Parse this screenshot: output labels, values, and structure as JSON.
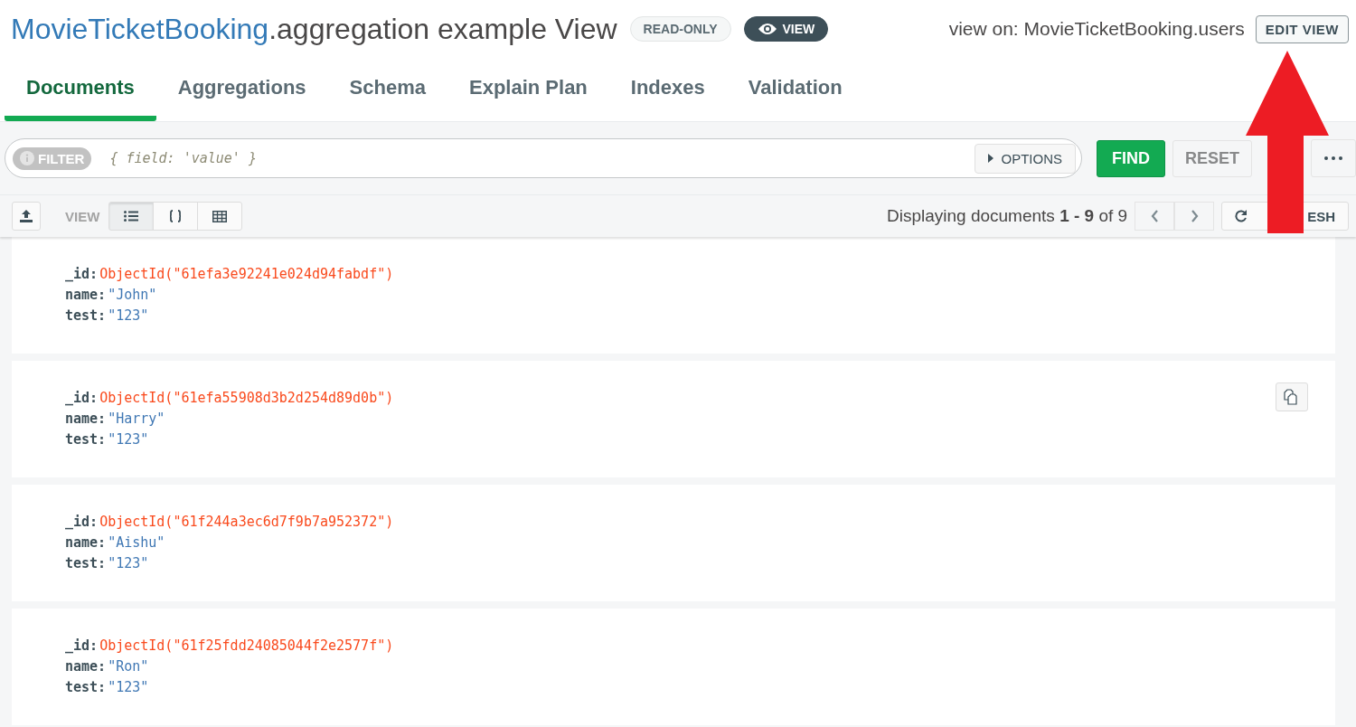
{
  "header": {
    "database": "MovieTicketBooking",
    "view_name": ".aggregation example View",
    "badges": [
      {
        "kind": "readonly",
        "label": "READ-ONLY"
      },
      {
        "kind": "view",
        "label": "VIEW"
      }
    ],
    "view_on": "view on: MovieTicketBooking.users",
    "edit_button": "EDIT VIEW"
  },
  "tabs": [
    {
      "label": "Documents",
      "selected": true
    },
    {
      "label": "Aggregations",
      "selected": false
    },
    {
      "label": "Schema",
      "selected": false
    },
    {
      "label": "Explain Plan",
      "selected": false
    },
    {
      "label": "Indexes",
      "selected": false
    },
    {
      "label": "Validation",
      "selected": false
    }
  ],
  "query_bar": {
    "filter_label": "FILTER",
    "placeholder": "{ field: 'value' }",
    "options_button": "OPTIONS",
    "find_button": "FIND",
    "reset_button": "RESET"
  },
  "toolbar": {
    "view_label": "VIEW",
    "view_modes": [
      {
        "kind": "list",
        "selected": true
      },
      {
        "kind": "json",
        "selected": false
      },
      {
        "kind": "table",
        "selected": false
      }
    ],
    "paging": "Displaying documents **1 - 9** of 9",
    "refresh_button": "ESH"
  },
  "documents": [
    {
      "hovered": false,
      "fields": [
        {
          "key": "_id:",
          "value": "ObjectId(\"61efa3e92241e024d94fabdf\")",
          "kind": "objectid"
        },
        {
          "key": "name:",
          "value": "\"John\"",
          "kind": "string"
        },
        {
          "key": "test:",
          "value": "\"123\"",
          "kind": "string"
        }
      ]
    },
    {
      "hovered": true,
      "fields": [
        {
          "key": "_id:",
          "value": "ObjectId(\"61efa55908d3b2d254d89d0b\")",
          "kind": "objectid"
        },
        {
          "key": "name:",
          "value": "\"Harry\"",
          "kind": "string"
        },
        {
          "key": "test:",
          "value": "\"123\"",
          "kind": "string"
        }
      ]
    },
    {
      "hovered": false,
      "fields": [
        {
          "key": "_id:",
          "value": "ObjectId(\"61f244a3ec6d7f9b7a952372\")",
          "kind": "objectid"
        },
        {
          "key": "name:",
          "value": "\"Aishu\"",
          "kind": "string"
        },
        {
          "key": "test:",
          "value": "\"123\"",
          "kind": "string"
        }
      ]
    },
    {
      "hovered": false,
      "fields": [
        {
          "key": "_id:",
          "value": "ObjectId(\"61f25fdd24085044f2e2577f\")",
          "kind": "objectid"
        },
        {
          "key": "name:",
          "value": "\"Ron\"",
          "kind": "string"
        },
        {
          "key": "test:",
          "value": "\"123\"",
          "kind": "string"
        }
      ]
    }
  ]
}
